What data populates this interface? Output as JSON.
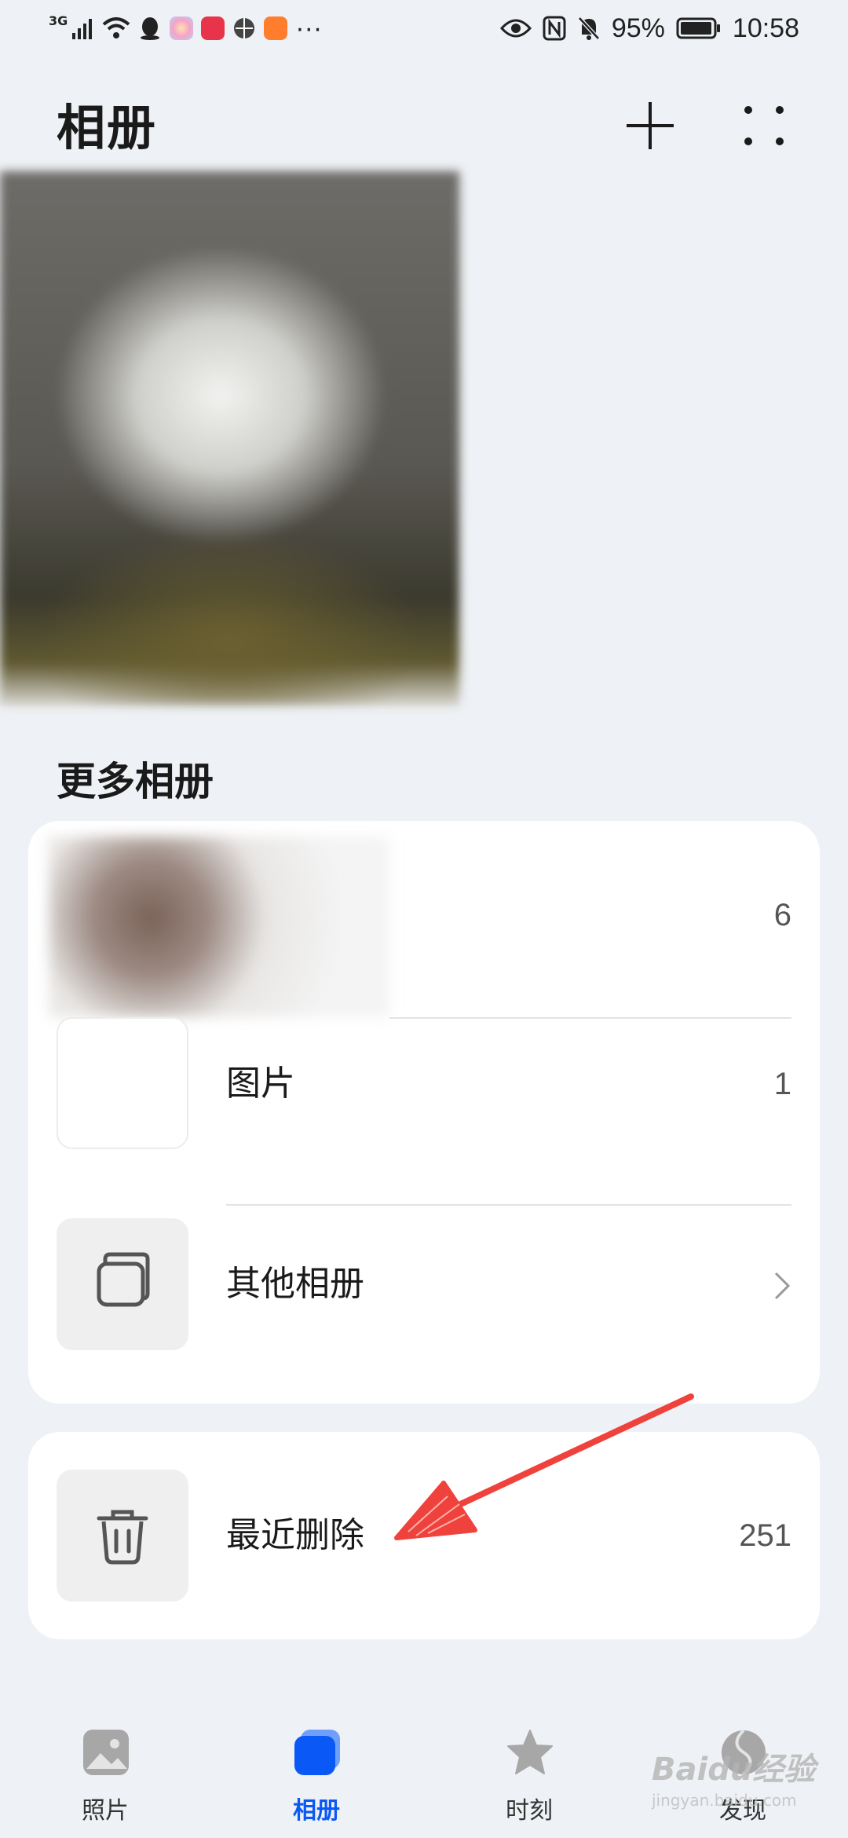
{
  "status_bar": {
    "network_type": "3G",
    "more_indicator": "···",
    "battery": "95%",
    "time": "10:58",
    "app_tile_colors": [
      "#f5c6d8",
      "#e8344b",
      "#444444",
      "#ff7d2d"
    ]
  },
  "header": {
    "title": "相册"
  },
  "section": {
    "title": "更多相册"
  },
  "albums": [
    {
      "label": "",
      "count": "6"
    },
    {
      "label": "图片",
      "count": "1"
    },
    {
      "label": "其他相册",
      "count": ""
    }
  ],
  "recently_deleted": {
    "label": "最近删除",
    "count": "251"
  },
  "bottom_nav": [
    {
      "label": "照片",
      "icon": "photos-icon",
      "active": false
    },
    {
      "label": "相册",
      "icon": "albums-icon",
      "active": true
    },
    {
      "label": "时刻",
      "icon": "star-icon",
      "active": false
    },
    {
      "label": "发现",
      "icon": "discover-icon",
      "active": false
    }
  ],
  "watermark": {
    "brand": "Baidu经验",
    "site": "jingyan.baidu.com"
  },
  "colors": {
    "accent": "#0a59f7",
    "annotation_arrow": "#f0423c",
    "background": "#eef1f5"
  }
}
